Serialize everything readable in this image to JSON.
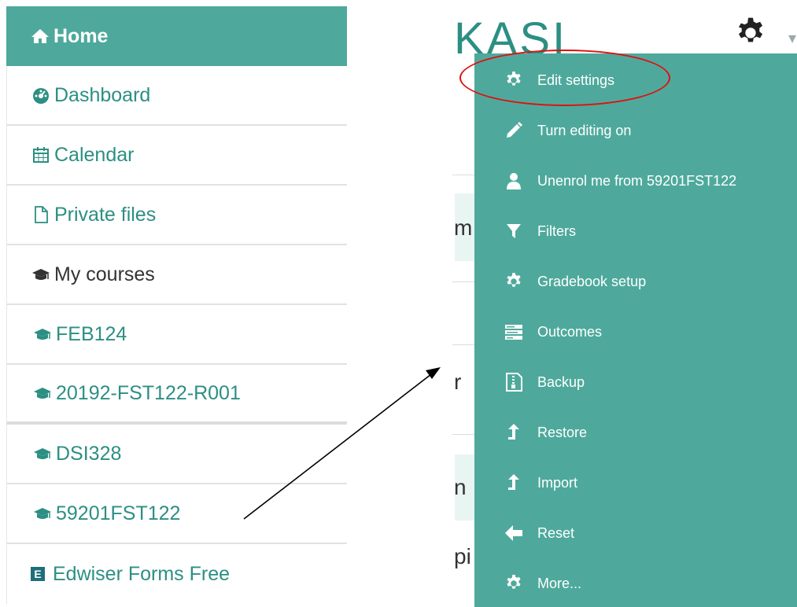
{
  "nav": {
    "items": [
      {
        "label": "Home",
        "icon": "home-icon"
      },
      {
        "label": "Dashboard",
        "icon": "dashboard-icon"
      },
      {
        "label": "Calendar",
        "icon": "calendar-icon"
      },
      {
        "label": "Private files",
        "icon": "file-icon"
      },
      {
        "label": "My courses",
        "icon": "graduation-cap-icon"
      },
      {
        "label": "FEB124",
        "icon": "graduation-cap-icon"
      },
      {
        "label": "20192-FST122-R001",
        "icon": "graduation-cap-icon"
      },
      {
        "label": "DSI328",
        "icon": "graduation-cap-icon"
      },
      {
        "label": "59201FST122",
        "icon": "graduation-cap-icon"
      },
      {
        "label": "Edwiser Forms Free",
        "icon": "edwiser-icon",
        "badge": "E"
      }
    ]
  },
  "background": {
    "logo_fragment": "KASI",
    "fragments": [
      "m",
      "r",
      "n",
      "pi"
    ]
  },
  "menu": {
    "items": [
      {
        "label": "Edit settings",
        "icon": "gear-icon"
      },
      {
        "label": "Turn editing on",
        "icon": "pencil-icon"
      },
      {
        "label": "Unenrol me from 59201FST122",
        "icon": "user-icon"
      },
      {
        "label": "Filters",
        "icon": "filter-icon"
      },
      {
        "label": "Gradebook setup",
        "icon": "gear-icon"
      },
      {
        "label": "Outcomes",
        "icon": "outcomes-icon"
      },
      {
        "label": "Backup",
        "icon": "archive-icon"
      },
      {
        "label": "Restore",
        "icon": "upload-arrow-icon"
      },
      {
        "label": "Import",
        "icon": "upload-arrow-icon"
      },
      {
        "label": "Reset",
        "icon": "arrow-left-icon"
      },
      {
        "label": "More...",
        "icon": "gear-icon"
      }
    ]
  },
  "colors": {
    "accent": "#4ea99c",
    "link": "#2c8f83",
    "annotation": "#e01010"
  }
}
